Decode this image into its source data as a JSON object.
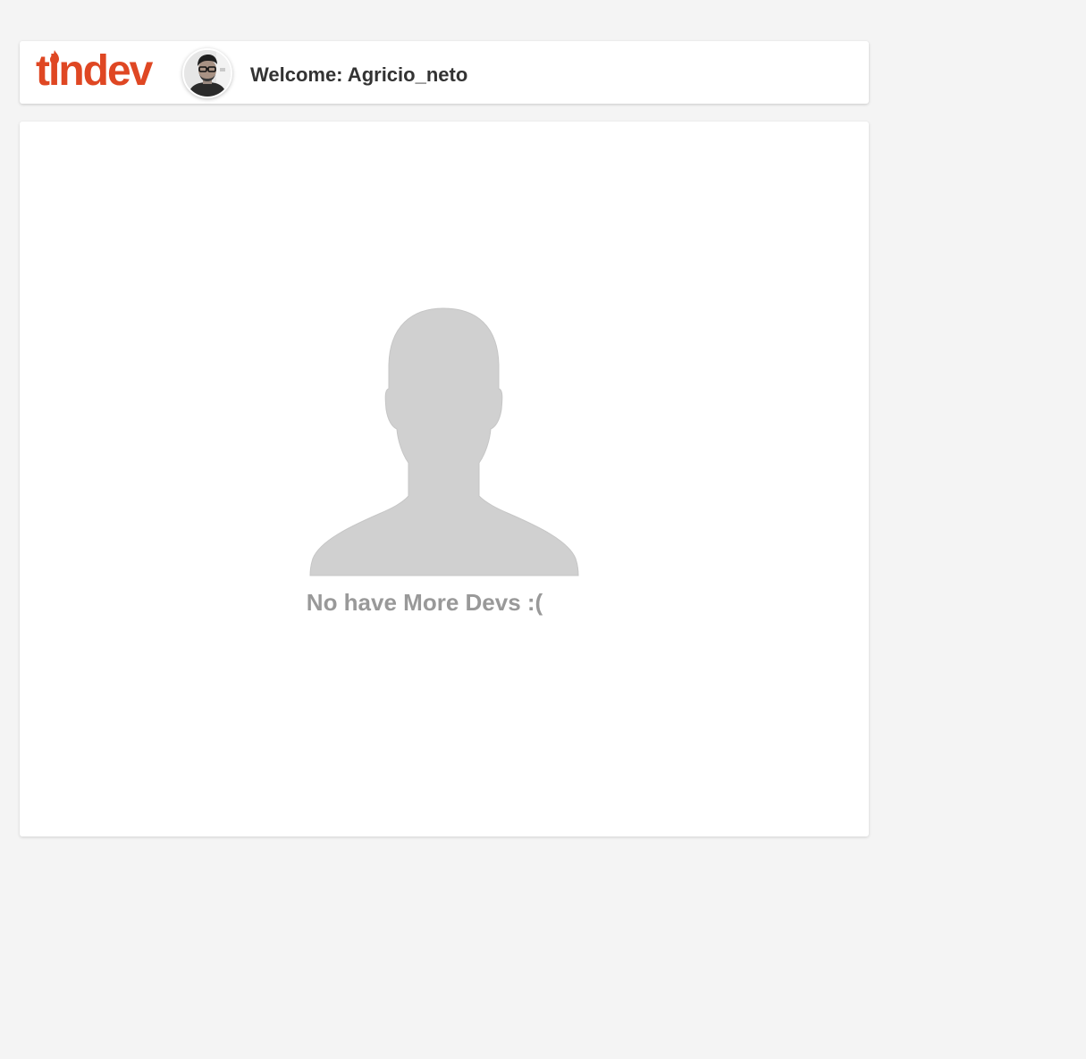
{
  "header": {
    "logo_text": "tindev",
    "welcome_text": "Welcome: Agricio_neto"
  },
  "main": {
    "empty_message": "No have More Devs :("
  },
  "colors": {
    "brand": "#df4723",
    "background": "#f4f4f4",
    "placeholder_silhouette": "#d0d0d0",
    "muted_text": "#999999",
    "header_text": "#333333"
  },
  "icons": {
    "avatar": "user-photo-avatar",
    "placeholder": "person-silhouette-icon"
  }
}
